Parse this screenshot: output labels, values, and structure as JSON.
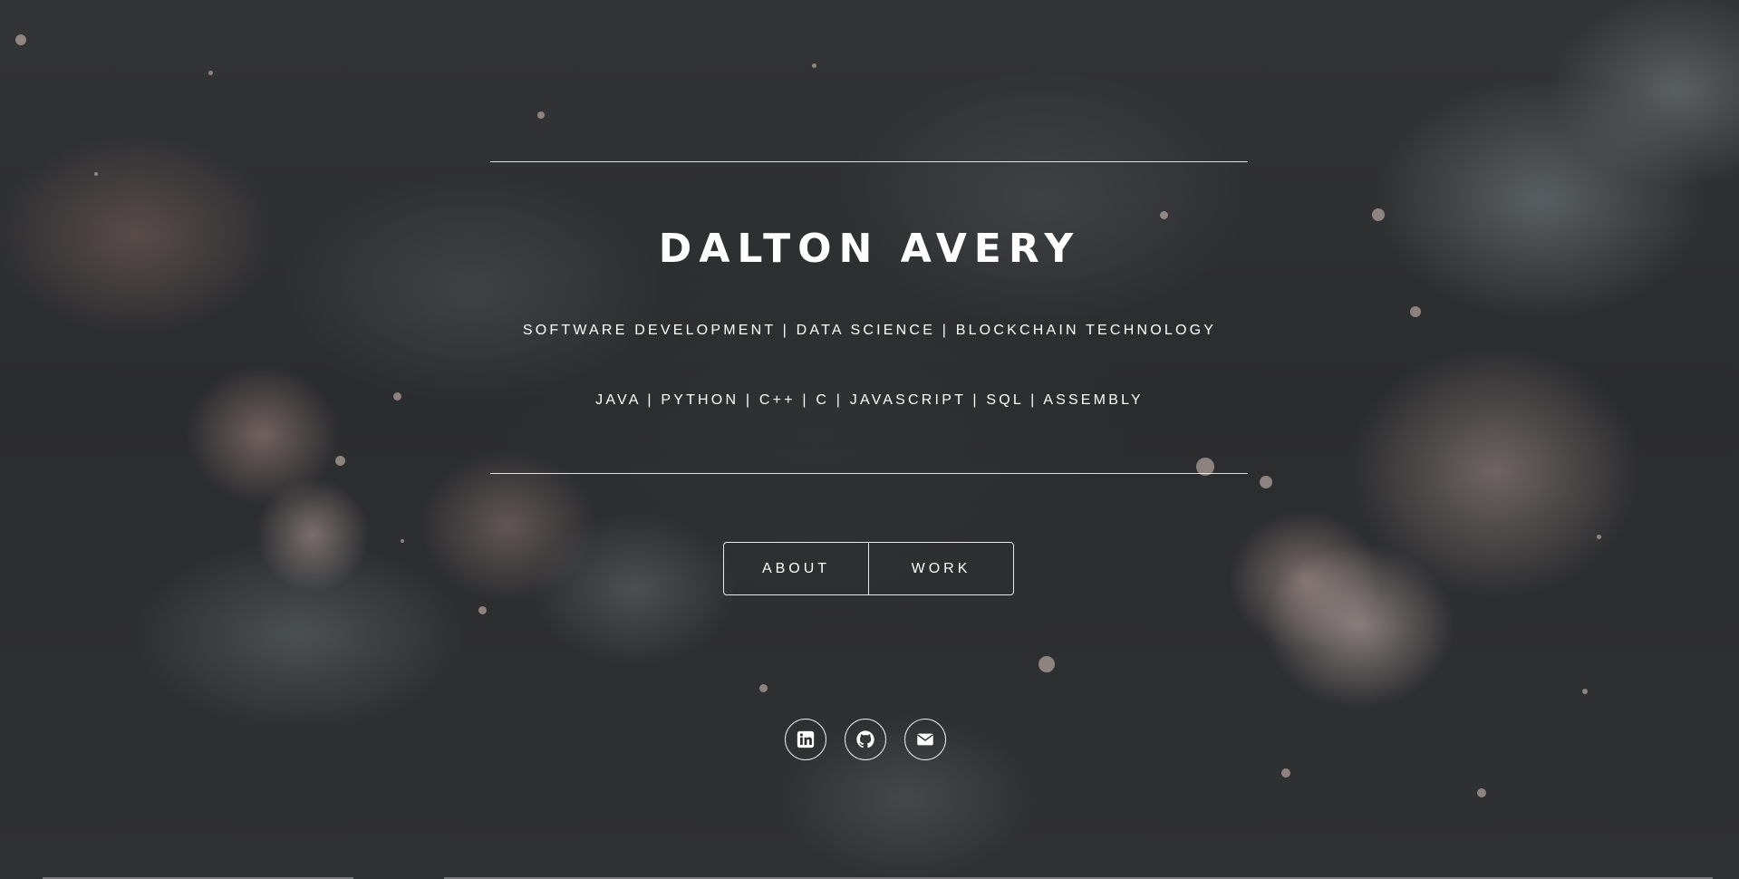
{
  "hero": {
    "name": "DALTON AVERY",
    "tagline": "SOFTWARE DEVELOPMENT | DATA SCIENCE | BLOCKCHAIN TECHNOLOGY",
    "languages": "JAVA | PYTHON | C++ | C | JAVASCRIPT | SQL | ASSEMBLY"
  },
  "nav": {
    "about_label": "ABOUT",
    "work_label": "WORK"
  },
  "social": {
    "icons": [
      "linkedin-icon",
      "github-icon",
      "envelope-icon"
    ]
  },
  "colors": {
    "text": "#ffffff",
    "background": "#2b2c2e"
  }
}
